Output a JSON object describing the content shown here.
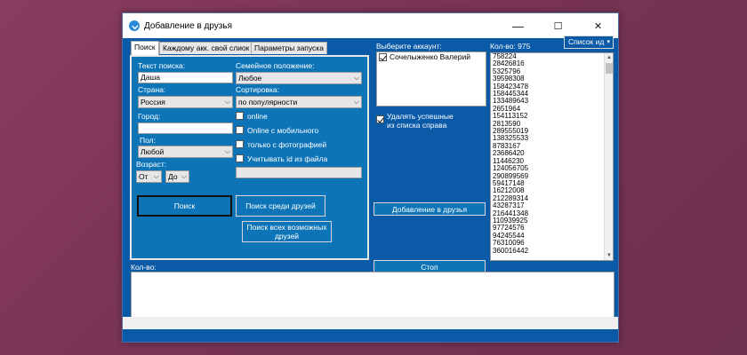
{
  "window": {
    "title": "Добавление в друзья",
    "minimize_glyph": "—",
    "maximize_glyph": "☐",
    "close_glyph": "✕"
  },
  "tabs": [
    {
      "label": "Поиск"
    },
    {
      "label": "Каждому акк. свой слиок ид"
    },
    {
      "label": "Параметры запуска"
    }
  ],
  "search": {
    "query_label": "Текст поиска:",
    "query_value": "Даша",
    "country_label": "Страна:",
    "country_value": "Россия",
    "city_label": "Город:",
    "city_value": "",
    "sex_label": "Пол:",
    "sex_value": "Любой",
    "age_label": "Возраст:",
    "age_from": "От",
    "age_to": "До",
    "marital_label": "Семейное положение:",
    "marital_value": "Любое",
    "sort_label": "Сортировка:",
    "sort_value": "по популярности",
    "opt_online": "online",
    "opt_online_mobile": "Online с мобильного",
    "opt_photo": "только с фотографией",
    "opt_file_ids": "Учитывать id из файла",
    "file_path_value": "",
    "search_button": "Поиск",
    "search_friends_button": "Поиск среди друзей",
    "search_all_friends_button": "Поиск всех возможных друзей"
  },
  "accounts": {
    "label": "Выберите аккаунт:",
    "items": [
      {
        "name": "Сочелыженко Валерий",
        "checked": true
      }
    ],
    "remove_success_label": "Удалять успешные из списка справа",
    "add_button": "Добавление в друзья",
    "stop_button": "Стоп"
  },
  "ids": {
    "count_label": "Кол-во: 975",
    "dropdown_label": "Список ид",
    "items": [
      "758224",
      "28426816",
      "5325796",
      "39598308",
      "158423478",
      "158445344",
      "133489643",
      "2651964",
      "154113152",
      "2813590",
      "289555019",
      "138325533",
      "8783167",
      "23686420",
      "11446230",
      "124056705",
      "290899569",
      "59417148",
      "16212008",
      "212289314",
      "43287317",
      "216441348",
      "110939925",
      "97724576",
      "94245544",
      "76310096",
      "360016442"
    ]
  },
  "log": {
    "count_label": "Кол-во:"
  }
}
